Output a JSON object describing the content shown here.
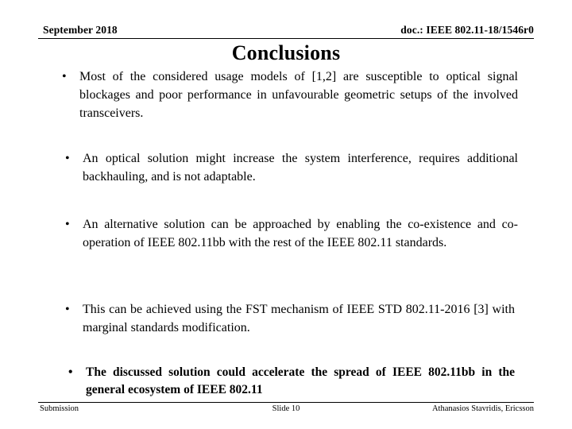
{
  "document": {
    "type": "presentation-slide",
    "background_color": "#ffffff",
    "text_color": "#000000"
  },
  "header": {
    "date": "September 2018",
    "doc_reference": "doc.: IEEE 802.11-18/1546r0"
  },
  "title": "Conclusions",
  "bullets": [
    {
      "marker": "•",
      "text": "Most of the considered usage models of [1,2] are susceptible to optical signal blockages and poor performance in unfavourable geometric setups of the involved transceivers.",
      "bold": false
    },
    {
      "marker": "•",
      "text": "An optical solution might increase the system interference, requires additional backhauling, and is not adaptable.",
      "bold": false
    },
    {
      "marker": "•",
      "text": "An alternative solution can be approached by enabling the co-existence and co-operation of IEEE 802.11bb with the rest of the IEEE 802.11 standards.",
      "bold": false
    },
    {
      "marker": "•",
      "text": "This can be achieved using the FST mechanism of IEEE STD 802.11-2016 [3] with  marginal standards modification.",
      "bold": false
    },
    {
      "marker": "•",
      "text": "The discussed solution could accelerate the spread of IEEE 802.11bb in the general ecosystem of IEEE 802.11",
      "bold": true
    }
  ],
  "footer": {
    "left": "Submission",
    "center": "Slide 10",
    "right": "Athanasios Stavridis, Ericsson"
  }
}
